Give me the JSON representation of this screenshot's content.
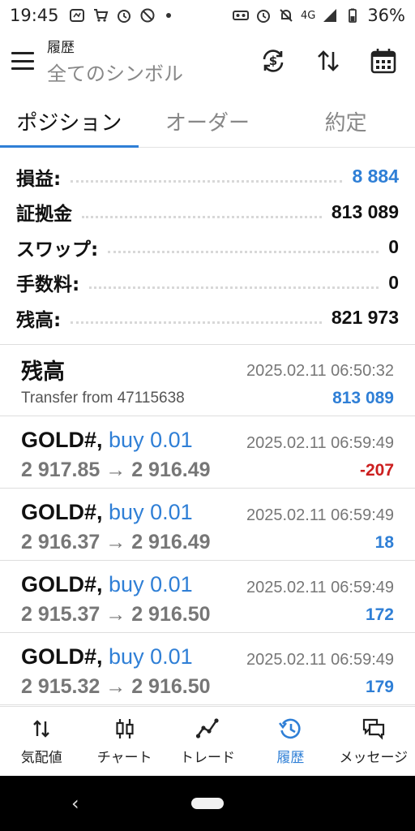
{
  "status_bar": {
    "time": "19:45",
    "signal_label": "4G",
    "battery_percent": "36%"
  },
  "app_bar": {
    "title_small": "履歴",
    "title_main": "全てのシンボル",
    "icons": [
      "menu-icon",
      "currency-sync-icon",
      "sort-icon",
      "calendar-icon"
    ]
  },
  "tabs": [
    {
      "label": "ポジション",
      "active": true
    },
    {
      "label": "オーダー",
      "active": false
    },
    {
      "label": "約定",
      "active": false
    }
  ],
  "summary": [
    {
      "label": "損益:",
      "value": "8 884",
      "color": "#2f7fd6"
    },
    {
      "label": "証拠金",
      "value": "813 089"
    },
    {
      "label": "スワップ:",
      "value": "0"
    },
    {
      "label": "手数料:",
      "value": "0"
    },
    {
      "label": "残高:",
      "value": "821 973"
    }
  ],
  "history": [
    {
      "title": "残高",
      "subtitle": "Transfer from 47115638",
      "timestamp": "2025.02.11 06:50:32",
      "amount": "813 089"
    },
    {
      "symbol": "GOLD#,",
      "type": "buy 0.01",
      "prices": "2 917.85 → 2 916.49",
      "timestamp": "2025.02.11 06:59:49",
      "amount": "-207",
      "negative": true
    },
    {
      "symbol": "GOLD#,",
      "type": "buy 0.01",
      "prices": "2 916.37 → 2 916.49",
      "timestamp": "2025.02.11 06:59:49",
      "amount": "18"
    },
    {
      "symbol": "GOLD#,",
      "type": "buy 0.01",
      "prices": "2 915.37 → 2 916.50",
      "timestamp": "2025.02.11 06:59:49",
      "amount": "172"
    },
    {
      "symbol": "GOLD#,",
      "type": "buy 0.01",
      "prices": "2 915.32 → 2 916.50",
      "timestamp": "2025.02.11 06:59:49",
      "amount": "179"
    }
  ],
  "bottom_nav": [
    {
      "label": "気配値",
      "icon": "quotes-icon"
    },
    {
      "label": "チャート",
      "icon": "chart-candles-icon"
    },
    {
      "label": "トレード",
      "icon": "trade-icon"
    },
    {
      "label": "履歴",
      "icon": "history-icon",
      "active": true
    },
    {
      "label": "メッセージ",
      "icon": "messages-icon"
    }
  ],
  "colors": {
    "accent": "#2f7fd6",
    "negative": "#cc1f1f"
  }
}
